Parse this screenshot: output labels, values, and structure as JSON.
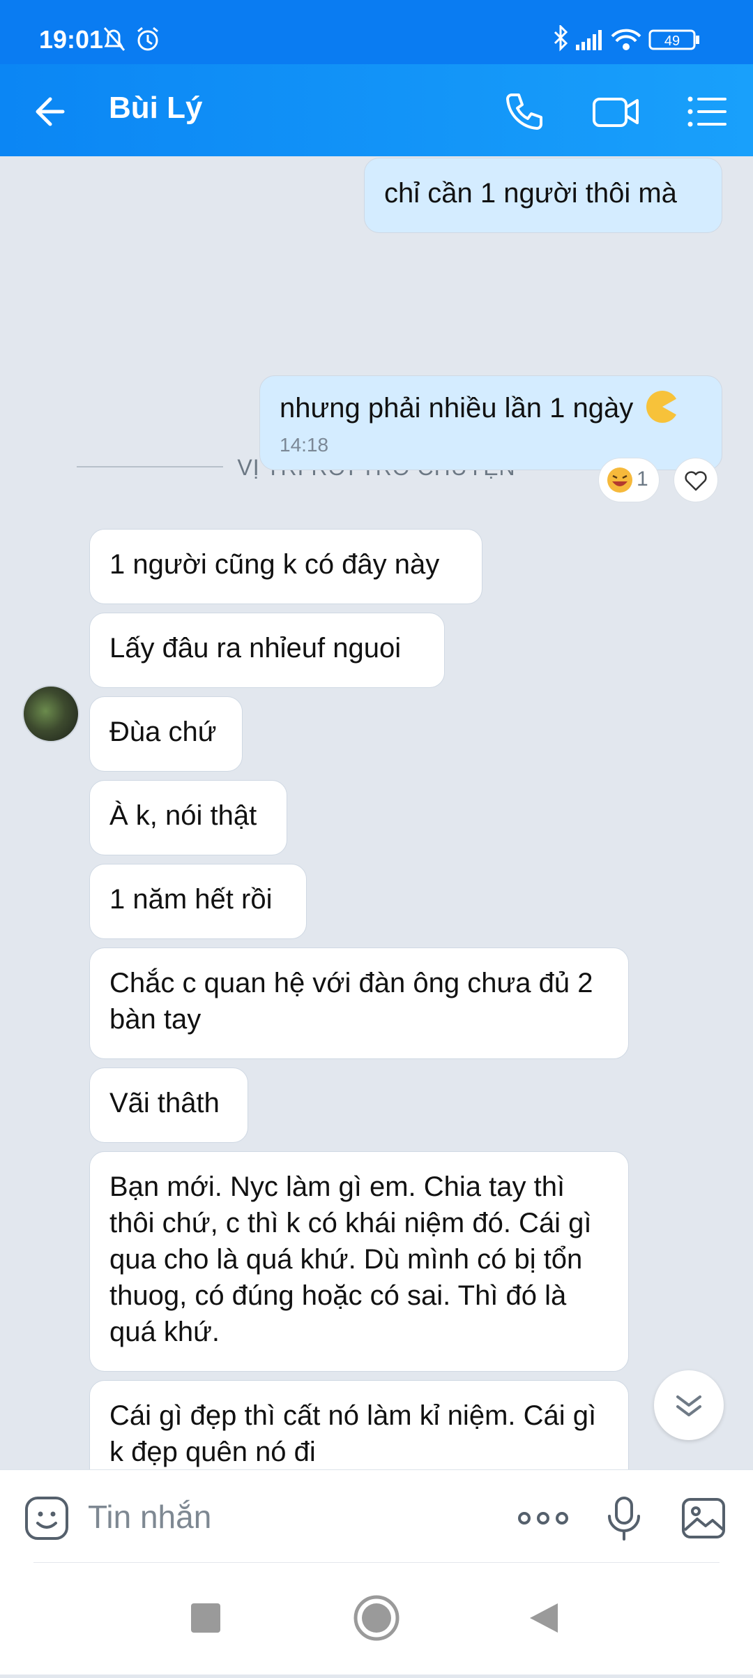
{
  "status_bar": {
    "time": "19:01",
    "battery": "49"
  },
  "header": {
    "contact_name": "Bùi Lý"
  },
  "messages": {
    "m1": "chỉ cần 1 người thôi mà",
    "divider": "VỊ TRÍ RỜI TRÒ CHUYỆN",
    "m2": "nhưng phải nhiều lần 1 ngày",
    "m2_time": "14:18",
    "m2_reaction_count": "1",
    "t1": "1 người cũng k có đây này",
    "t2": "Lấy đâu ra nhỉeuf nguoi",
    "t3": "Đùa chứ",
    "t4": "À k, nói thật",
    "t5": "1 năm hết rồi",
    "t6": "Chắc c quan hệ với đàn ông chưa đủ 2 bàn tay",
    "t7": "Vãi thâth",
    "t8": "Bạn mới. Nyc làm gì em. Chia tay thì thôi chứ, c thì k có khái niệm đó. Cái gì qua cho là quá khứ. Dù mình có bị tổn thuog, có đúng hoặc có sai. Thì đó là quá khứ.",
    "t9": "Cái gì đẹp thì cất nó làm kỉ niệm. Cái gì k đẹp quên nó đi"
  },
  "input": {
    "placeholder": "Tin nhắn"
  },
  "colors": {
    "accent": "#0a7cf2",
    "my_bubble": "#d4ecff",
    "background": "#e2e7ee"
  }
}
